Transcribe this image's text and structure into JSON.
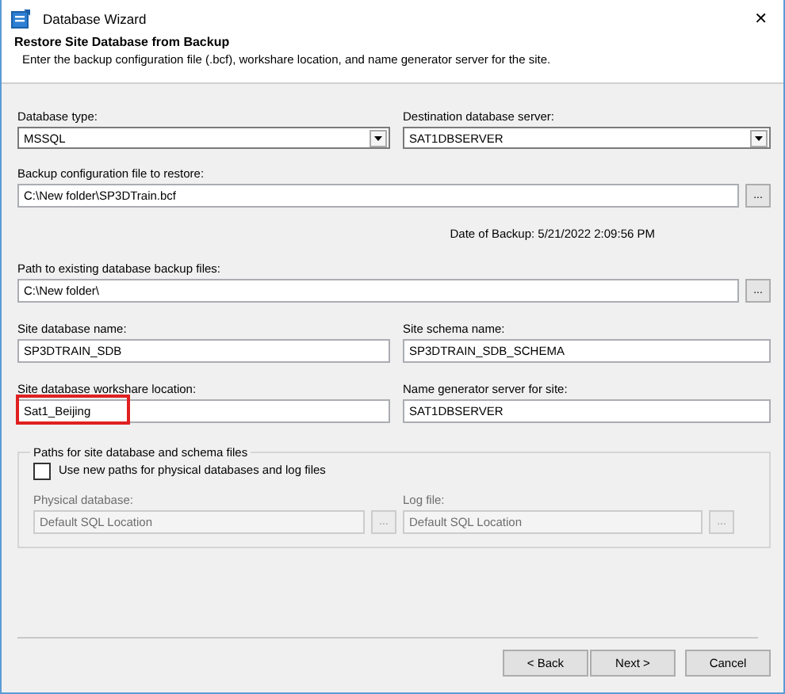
{
  "window": {
    "title": "Database Wizard",
    "close": "✕"
  },
  "header": {
    "title": "Restore Site Database from Backup",
    "subtitle": "Enter the backup configuration file (.bcf), workshare location, and name generator server for the site."
  },
  "database_type": {
    "label": "Database type:",
    "value": "MSSQL"
  },
  "destination_server": {
    "label": "Destination database server:",
    "value": "SAT1DBSERVER"
  },
  "backup_file": {
    "label": "Backup configuration file to restore:",
    "value": "C:\\New folder\\SP3DTrain.bcf",
    "browse": "..."
  },
  "backup_date": "Date of Backup: 5/21/2022 2:09:56 PM",
  "backup_path": {
    "label": "Path to existing database backup files:",
    "value": "C:\\New folder\\",
    "browse": "..."
  },
  "pairs": [
    {
      "label": "Site database name:",
      "value": "SP3DTRAIN_SDB",
      "highlighted": false
    },
    {
      "label": "Site schema name:",
      "value": "SP3DTRAIN_SDB_SCHEMA",
      "highlighted": false
    },
    {
      "label": "Site database workshare location:",
      "value": "Sat1_Beijing",
      "highlighted": true
    },
    {
      "label": "Name generator server for site:",
      "value": "SAT1DBSERVER",
      "highlighted": false
    }
  ],
  "paths_group": {
    "legend": "Paths for site database and schema files",
    "checkbox": {
      "label": "Use new paths for physical databases and log files",
      "checked": false
    },
    "fields": [
      {
        "label": "Physical database:",
        "value": "Default SQL Location",
        "disabled": true,
        "browse": "..."
      },
      {
        "label": "Log file:",
        "value": "Default SQL Location",
        "disabled": true,
        "browse": "..."
      }
    ]
  },
  "buttons": [
    {
      "label": "< Back"
    },
    {
      "label": "Next >"
    },
    {
      "label": "Cancel"
    }
  ]
}
